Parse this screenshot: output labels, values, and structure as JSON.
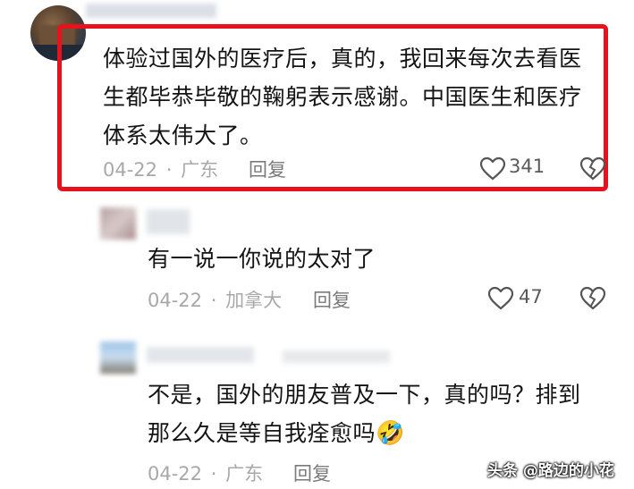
{
  "comments": [
    {
      "text_lines": [
        "体验过国外的医疗后，真的，我回来每次去看医",
        "生都毕恭毕敬的鞠躬表示感谢。中国医生和医疗",
        "体系太伟大了。"
      ],
      "date": "04-22",
      "separator": "·",
      "location": "广东",
      "reply_label": "回复",
      "likes": "341"
    },
    {
      "text_lines": [
        "有一说一你说的太对了"
      ],
      "date": "04-22",
      "separator": "·",
      "location": "加拿大",
      "reply_label": "回复",
      "likes": "47"
    },
    {
      "text_lines": [
        "不是，国外的朋友普及一下，真的吗？排到",
        "那么久是等自我痊愈吗"
      ],
      "date": "04-22",
      "separator": "·",
      "location": "广东",
      "reply_label": "回复",
      "likes": ""
    }
  ],
  "emoji": "🤣",
  "watermark": "头条 @路边的小花",
  "colors": {
    "highlight_border": "#e8121d",
    "text": "#141414",
    "meta": "#a8a8a8"
  }
}
